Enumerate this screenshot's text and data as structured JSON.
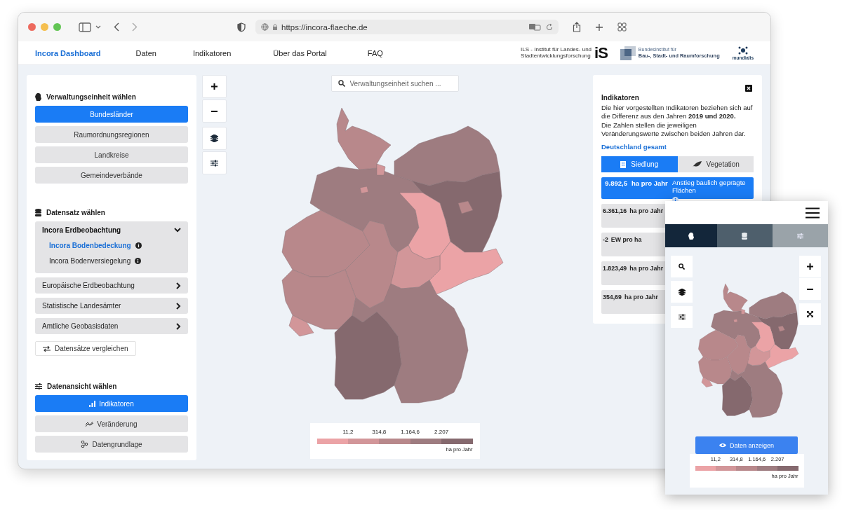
{
  "browser": {
    "url": "https://incora-flaeche.de"
  },
  "nav": {
    "brand": "Incora Dashboard",
    "links": [
      "Daten",
      "Indikatoren",
      "Über das Portal",
      "FAQ"
    ]
  },
  "logos": {
    "ils_text": [
      "ILS - Institut für Landes- und",
      "Stadtentwicklungsforschung"
    ],
    "ils_mark": "iS",
    "bbsr_text": [
      "Bundesinstitut für",
      "Bau-, Stadt- und Raumforschung"
    ],
    "mundialis": "mundialis"
  },
  "left_panel": {
    "units": {
      "title": "Verwaltungseinheit wählen",
      "options": [
        {
          "label": "Bundesländer",
          "selected": true
        },
        {
          "label": "Raumordnungsregionen",
          "selected": false
        },
        {
          "label": "Landkreise",
          "selected": false
        },
        {
          "label": "Gemeindeverbände",
          "selected": false
        }
      ]
    },
    "datasets": {
      "title": "Datensatz wählen",
      "groups": [
        {
          "label": "Incora Erdbeobachtung",
          "expanded": true,
          "children": [
            {
              "label": "Incora Bodenbedeckung",
              "selected": true
            },
            {
              "label": "Incora Bodenversiegelung",
              "selected": false
            }
          ]
        },
        {
          "label": "Europäische Erdbeobachtung",
          "expanded": false
        },
        {
          "label": "Statistische Landesämter",
          "expanded": false
        },
        {
          "label": "Amtliche Geobasisdaten",
          "expanded": false
        }
      ],
      "compare_button": "Datensätze vergleichen"
    },
    "views": {
      "title": "Datenansicht wählen",
      "options": [
        {
          "label": "Indikatoren",
          "kind": "bars",
          "selected": true
        },
        {
          "label": "Veränderung",
          "kind": "trend",
          "selected": false
        },
        {
          "label": "Datengrundlage",
          "kind": "nodes",
          "selected": false
        }
      ]
    }
  },
  "map": {
    "search_placeholder": "Verwaltungseinheit suchen ..."
  },
  "legend": {
    "ticks": [
      "11,2",
      "314,8",
      "1.164,6",
      "2.207"
    ],
    "swatches": [
      {
        "color": "#eba3a6"
      },
      {
        "color": "#d29699"
      },
      {
        "color": "#b8888b"
      },
      {
        "color": "#9e7c80"
      },
      {
        "color": "#85696e"
      }
    ],
    "unit": "ha pro Jahr"
  },
  "indicators": {
    "title": "Indikatoren",
    "text": [
      "Die hier vorgestellten Indikatoren beziehen sich auf die Differenz aus den Jahren **2019 und 2020.**",
      "Die Zahlen stellen die jeweiligen Veränderungswerte zwischen beiden Jahren dar."
    ],
    "link": "Deutschland gesamt",
    "tabs": [
      {
        "label": "Siedlung",
        "kind": "building",
        "selected": true
      },
      {
        "label": "Vegetation",
        "kind": "leaf",
        "selected": false
      }
    ],
    "items": [
      {
        "value": "9.892,5",
        "unit": "ha pro Jahr",
        "description": "Anstieg baulich geprägte Flächen",
        "selected": true
      },
      {
        "value": "6.361,16",
        "unit": "ha pro Jahr",
        "selected": false
      },
      {
        "value": "-2",
        "unit": "EW pro ha",
        "selected": false
      },
      {
        "value": "1.823,49",
        "unit": "ha pro Jahr",
        "selected": false
      },
      {
        "value": "354,69",
        "unit": "ha pro Jahr",
        "selected": false
      }
    ]
  },
  "mobile": {
    "tabs": [
      {
        "kind": "germany",
        "selected": true
      },
      {
        "kind": "database",
        "selected": false
      },
      {
        "kind": "sliders",
        "selected": false
      }
    ],
    "button": "Daten anzeigen",
    "legend": {
      "ticks": [
        "11,2",
        "314,8",
        "1.164,6",
        "2.207"
      ],
      "swatches": [
        {
          "color": "#eba3a6"
        },
        {
          "color": "#d29699"
        },
        {
          "color": "#b8888b"
        },
        {
          "color": "#9e7c80"
        },
        {
          "color": "#85696e"
        }
      ],
      "unit": "ha pro Jahr"
    }
  }
}
